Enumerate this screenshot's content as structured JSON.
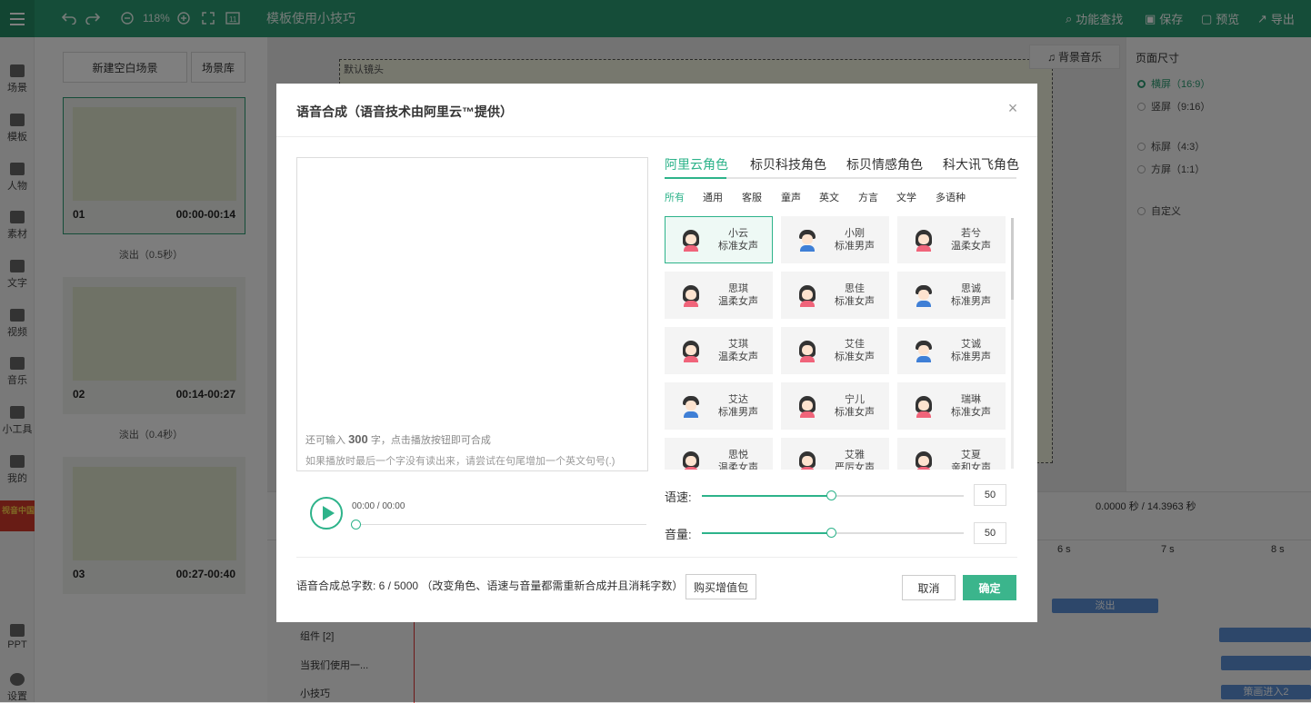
{
  "topbar": {
    "zoom": "118%",
    "title": "模板使用小技巧",
    "func_search": "功能查找",
    "save": "保存",
    "preview": "预览",
    "export": "导出"
  },
  "leftbar": {
    "items": [
      "场景",
      "模板",
      "人物",
      "素材",
      "文字",
      "视频",
      "音乐",
      "小工具",
      "我的",
      "PPT",
      "设置"
    ],
    "badge": "视音中国"
  },
  "scenes": {
    "new_blank": "新建空白场景",
    "library": "场景库",
    "cards": [
      {
        "num": "01",
        "time": "00:00-00:14"
      },
      {
        "num": "02",
        "time": "00:14-00:27"
      },
      {
        "num": "03",
        "time": "00:27-00:40"
      }
    ],
    "transitions": [
      "淡出（0.5秒）",
      "淡出（0.4秒）"
    ]
  },
  "canvas": {
    "default_lens": "默认镜头",
    "bgm": "背景音乐"
  },
  "page_size": {
    "title": "页面尺寸",
    "options": [
      "横屏（16:9）",
      "竖屏（9:16）",
      "标屏（4:3）",
      "方屏（1:1）",
      "自定义"
    ],
    "selected": "横屏（16:9）"
  },
  "timeline": {
    "time": "0.0000 秒 / 14.3963 秒",
    "ticks": [
      "6 s",
      "7 s",
      "8 s"
    ],
    "tracks": [
      "组件 [2]",
      "当我们使用一...",
      "小技巧"
    ],
    "clip_fade": "淡出",
    "clip_enter": "策画进入2"
  },
  "modal": {
    "title": "语音合成（语音技术由阿里云™提供）",
    "hint_prefix": "还可输入",
    "hint_count": "300",
    "hint_suffix": "字，点击播放按钮即可合成",
    "hint2": "如果播放时最后一个字没有读出来，请尝试在句尾增加一个英文句号(.)",
    "player_time": "00:00 / 00:00",
    "tabs": [
      "阿里云角色",
      "标贝科技角色",
      "标贝情感角色",
      "科大讯飞角色"
    ],
    "categories": [
      "所有",
      "通用",
      "客服",
      "童声",
      "英文",
      "方言",
      "文学",
      "多语种"
    ],
    "voices": [
      {
        "name": "小云",
        "desc": "标准女声",
        "g": "f"
      },
      {
        "name": "小刚",
        "desc": "标准男声",
        "g": "m"
      },
      {
        "name": "若兮",
        "desc": "温柔女声",
        "g": "f"
      },
      {
        "name": "思琪",
        "desc": "温柔女声",
        "g": "f"
      },
      {
        "name": "思佳",
        "desc": "标准女声",
        "g": "f"
      },
      {
        "name": "思诚",
        "desc": "标准男声",
        "g": "m"
      },
      {
        "name": "艾琪",
        "desc": "温柔女声",
        "g": "f"
      },
      {
        "name": "艾佳",
        "desc": "标准女声",
        "g": "f"
      },
      {
        "name": "艾诚",
        "desc": "标准男声",
        "g": "m"
      },
      {
        "name": "艾达",
        "desc": "标准男声",
        "g": "m"
      },
      {
        "name": "宁儿",
        "desc": "标准女声",
        "g": "f"
      },
      {
        "name": "瑞琳",
        "desc": "标准女声",
        "g": "f"
      },
      {
        "name": "思悦",
        "desc": "温柔女声",
        "g": "f"
      },
      {
        "name": "艾雅",
        "desc": "严厉女声",
        "g": "f"
      },
      {
        "name": "艾夏",
        "desc": "亲和女声",
        "g": "f"
      }
    ],
    "speed_label": "语速:",
    "speed_value": "50",
    "volume_label": "音量:",
    "volume_value": "50",
    "total_chars": "语音合成总字数:  6 / 5000  （改变角色、语速与音量都需重新合成并且消耗字数）",
    "buy": "购买增值包",
    "cancel": "取消",
    "confirm": "确定"
  }
}
